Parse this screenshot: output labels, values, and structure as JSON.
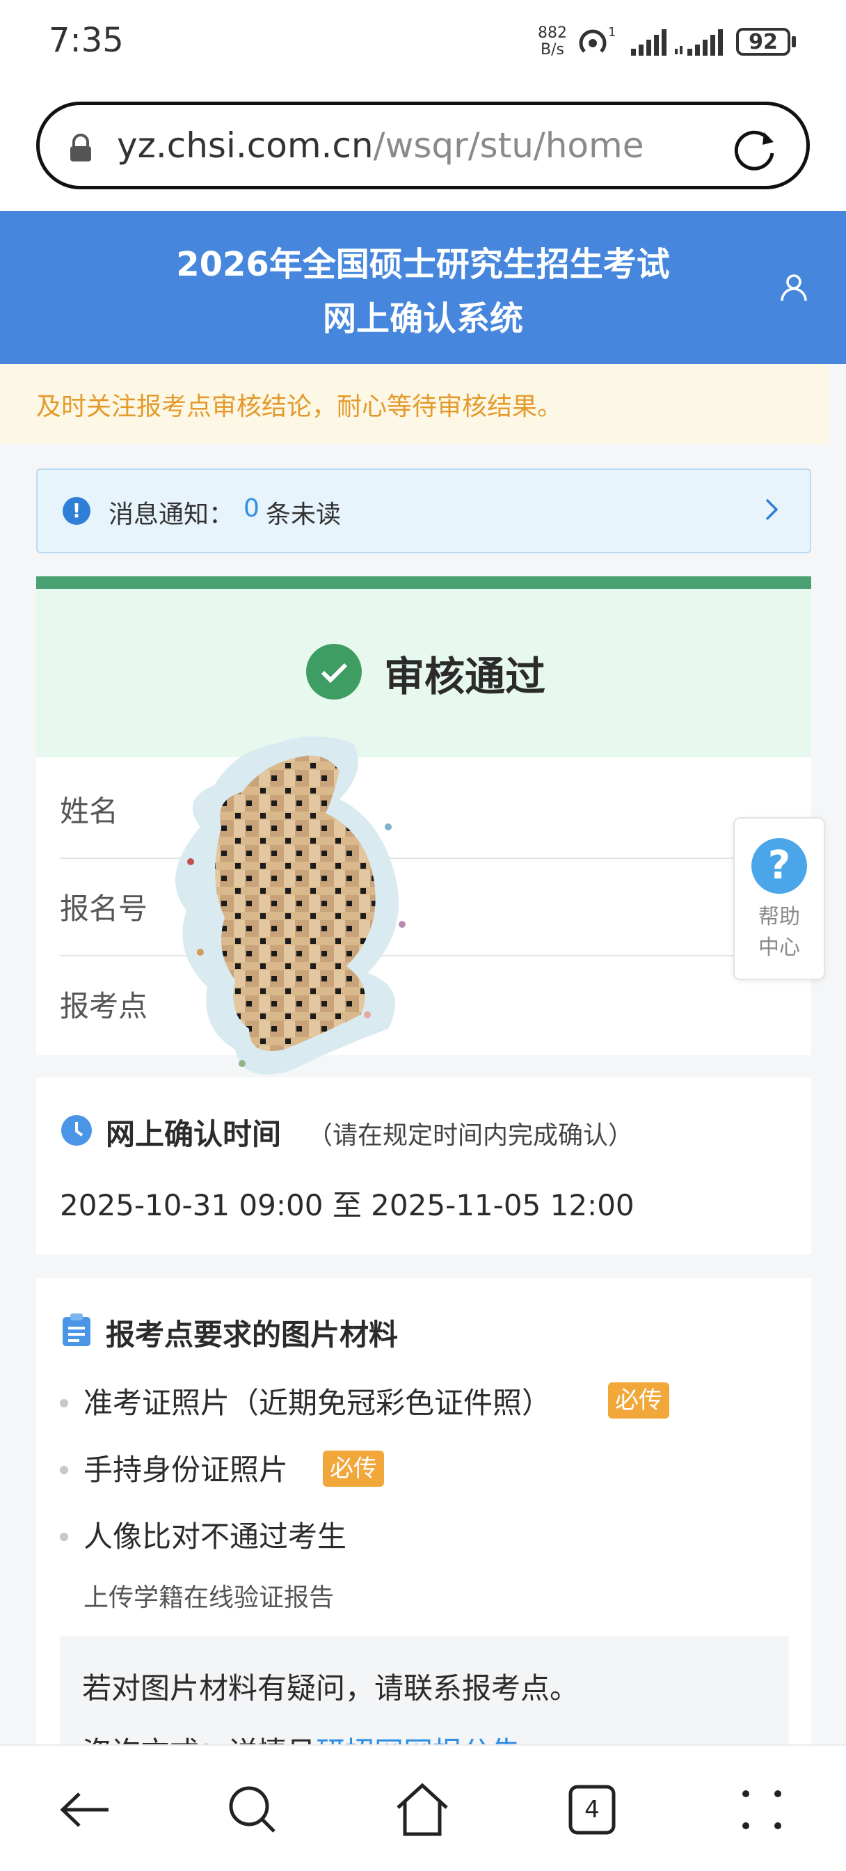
{
  "status_bar": {
    "time": "7:35",
    "net_speed_value": "882",
    "net_speed_unit": "B/s",
    "hotspot_count": "1",
    "battery": "92"
  },
  "browser": {
    "url_domain": "yz.chsi.com.cn",
    "url_path": "/wsqr/stu/home"
  },
  "header": {
    "title_line1": "2026年全国硕士研究生招生考试",
    "title_line2": "网上确认系统"
  },
  "notice": {
    "text": "及时关注报考点审核结论，耐心等待审核结果。"
  },
  "messages": {
    "label": "消息通知：",
    "count": "0",
    "suffix": "条未读"
  },
  "review": {
    "status": "审核通过",
    "status_color": "#3e9d62"
  },
  "info": {
    "name_label": "姓名",
    "regno_label": "报名号",
    "site_label": "报考点"
  },
  "help": {
    "line1": "帮助",
    "line2": "中心"
  },
  "confirm_time": {
    "title": "网上确认时间",
    "note": "（请在规定时间内完成确认）",
    "range": "2025-10-31 09:00 至 2025-11-05 12:00"
  },
  "materials": {
    "title": "报考点要求的图片材料",
    "items": [
      {
        "text": "准考证照片（近期免冠彩色证件照）",
        "badge": "必传"
      },
      {
        "text": "手持身份证照片",
        "badge": "必传"
      },
      {
        "text": "人像比对不通过考生",
        "sub": "上传学籍在线验证报告"
      }
    ],
    "faq_line1": "若对图片材料有疑问，请联系报考点。",
    "faq_line2_prefix": "咨询方式：详情见",
    "faq_link": "研招网网报公告"
  },
  "bottom_nav": {
    "tabs_count": "4"
  },
  "colors": {
    "header_blue": "#4687dd",
    "badge_orange": "#f2a73b",
    "notice_orange": "#e49a2b",
    "success_green": "#3e9d62"
  }
}
